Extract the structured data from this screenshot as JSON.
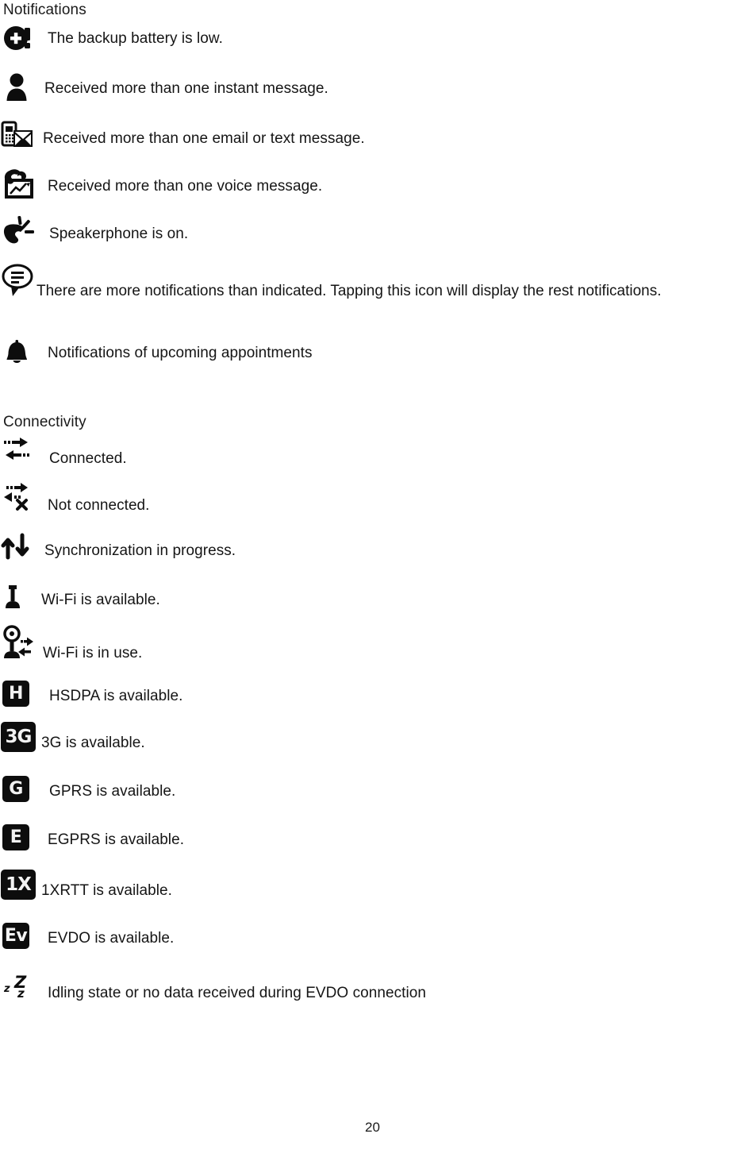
{
  "document": {
    "page_number": "20",
    "sections": [
      {
        "heading": "Notifications",
        "items": [
          {
            "icon": "battery-low-icon",
            "text": "The backup battery is low."
          },
          {
            "icon": "person-instant-message-icon",
            "text": "Received more than one instant message."
          },
          {
            "icon": "phone-email-message-icon",
            "text": "Received more than one email or text message."
          },
          {
            "icon": "voice-message-icon",
            "text": "Received more than one voice message."
          },
          {
            "icon": "speakerphone-icon",
            "text": "Speakerphone is on."
          },
          {
            "icon": "more-notifications-icon",
            "text": "There are more notifications than indicated. Tapping this icon will display the rest notifications."
          },
          {
            "icon": "bell-icon",
            "text": "Notifications of upcoming appointments"
          }
        ]
      },
      {
        "heading": "Connectivity",
        "items": [
          {
            "icon": "connected-arrows-icon",
            "text": "Connected."
          },
          {
            "icon": "not-connected-arrows-icon",
            "text": "Not connected."
          },
          {
            "icon": "sync-in-progress-icon",
            "text": "Synchronization in progress."
          },
          {
            "icon": "wifi-available-icon",
            "text": "Wi-Fi is available."
          },
          {
            "icon": "wifi-in-use-icon",
            "text": "Wi-Fi is in use."
          },
          {
            "icon": "hsdpa-badge-icon",
            "badge": "H",
            "text": "HSDPA is available."
          },
          {
            "icon": "3g-badge-icon",
            "badge": "3G",
            "text": "3G is available."
          },
          {
            "icon": "gprs-badge-icon",
            "badge": "G",
            "text": "GPRS is available."
          },
          {
            "icon": "egprs-badge-icon",
            "badge": "E",
            "text": "EGPRS is available."
          },
          {
            "icon": "1xrtt-badge-icon",
            "badge": "1X",
            "text": "1XRTT is available."
          },
          {
            "icon": "evdo-badge-icon",
            "badge": "Ev",
            "text": "EVDO is available."
          },
          {
            "icon": "idle-zzz-icon",
            "text": "Idling state or no data received during EVDO connection"
          }
        ]
      }
    ]
  }
}
